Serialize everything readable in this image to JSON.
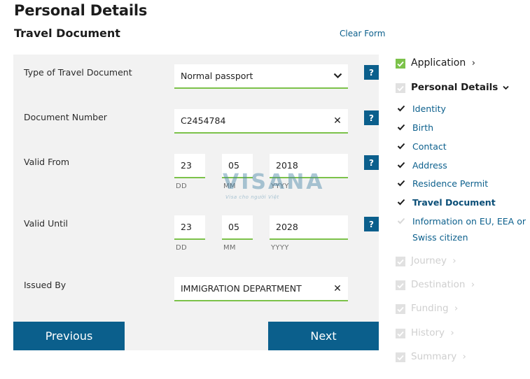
{
  "header": {
    "page_title": "Personal Details",
    "section_title": "Travel Document",
    "clear_form": "Clear Form"
  },
  "form": {
    "document_type": {
      "label": "Type of Travel Document",
      "value": "Normal passport",
      "help": "?"
    },
    "document_number": {
      "label": "Document Number",
      "value": "C2454784",
      "help": "?"
    },
    "valid_from": {
      "label": "Valid From",
      "day": "23",
      "month": "05",
      "year": "2018",
      "day_hint": "DD",
      "month_hint": "MM",
      "year_hint": "YYYY",
      "help": "?"
    },
    "valid_until": {
      "label": "Valid Until",
      "day": "23",
      "month": "05",
      "year": "2028",
      "day_hint": "DD",
      "month_hint": "MM",
      "year_hint": "YYYY",
      "help": "?"
    },
    "issued_by": {
      "label": "Issued By",
      "value": "IMMIGRATION DEPARTMENT"
    },
    "clear_glyph": "✕"
  },
  "buttons": {
    "previous": "Previous",
    "next": "Next"
  },
  "watermark": {
    "brand": "VISANA",
    "tagline": "Visa cho người Việt"
  },
  "sidebar": {
    "application": "Application",
    "personal_details": "Personal Details",
    "sub_items": [
      "Identity",
      "Birth",
      "Contact",
      "Address",
      "Residence Permit",
      "Travel Document",
      "Information on EU, EEA or",
      "Swiss citizen"
    ],
    "journey": "Journey",
    "destination": "Destination",
    "funding": "Funding",
    "history": "History",
    "summary": "Summary",
    "chevron": "›"
  },
  "colors": {
    "accent": "#0b5f8c",
    "field_underline": "#7cc24a",
    "panel_bg": "#f2f2f2"
  }
}
